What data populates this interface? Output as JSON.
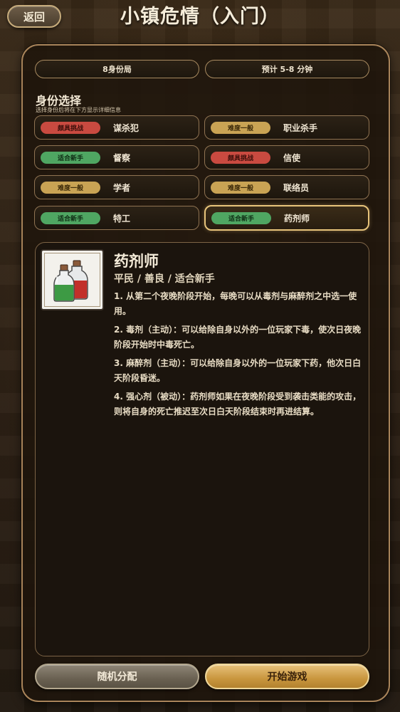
{
  "header": {
    "back_label": "返回",
    "title": "小镇危情（入门）"
  },
  "info": {
    "players": "8身份局",
    "duration": "预计 5-8 分钟"
  },
  "selection": {
    "title": "身份选择",
    "subtitle": "选择身份后将在下方显示详细信息"
  },
  "roles": [
    {
      "tag": "颇具挑战",
      "level": "hard",
      "name": "谋杀犯",
      "selected": false
    },
    {
      "tag": "难度一般",
      "level": "mid",
      "name": "职业杀手",
      "selected": false
    },
    {
      "tag": "适合新手",
      "level": "easy",
      "name": "督察",
      "selected": false
    },
    {
      "tag": "颇具挑战",
      "level": "hard",
      "name": "信使",
      "selected": false
    },
    {
      "tag": "难度一般",
      "level": "mid",
      "name": "学者",
      "selected": false
    },
    {
      "tag": "难度一般",
      "level": "mid",
      "name": "联络员",
      "selected": false
    },
    {
      "tag": "适合新手",
      "level": "easy",
      "name": "特工",
      "selected": false
    },
    {
      "tag": "适合新手",
      "level": "easy",
      "name": "药剂师",
      "selected": true
    }
  ],
  "detail": {
    "name": "药剂师",
    "meta": "平民 / 善良 / 适合新手",
    "icon": "potion-bottles-icon",
    "lines": [
      "1. 从第二个夜晚阶段开始，每晚可以从毒剂与麻醉剂之中选一使用。",
      "2. 毒剂（主动）：可以给除自身以外的一位玩家下毒，使次日夜晚阶段开始时中毒死亡。",
      "3. 麻醉剂（主动）：可以给除自身以外的一位玩家下药，他次日白天阶段昏迷。",
      "4. 强心剂（被动）：药剂师如果在夜晚阶段受到袭击类能的攻击，则将自身的死亡推迟至次日白天阶段结束时再进结算。"
    ]
  },
  "buttons": {
    "random": "随机分配",
    "start": "开始游戏"
  },
  "colors": {
    "accent_gold": "#e8c47b",
    "hard_tag": "#c94a40",
    "mid_tag": "#c9a354",
    "easy_tag": "#4fa662"
  }
}
